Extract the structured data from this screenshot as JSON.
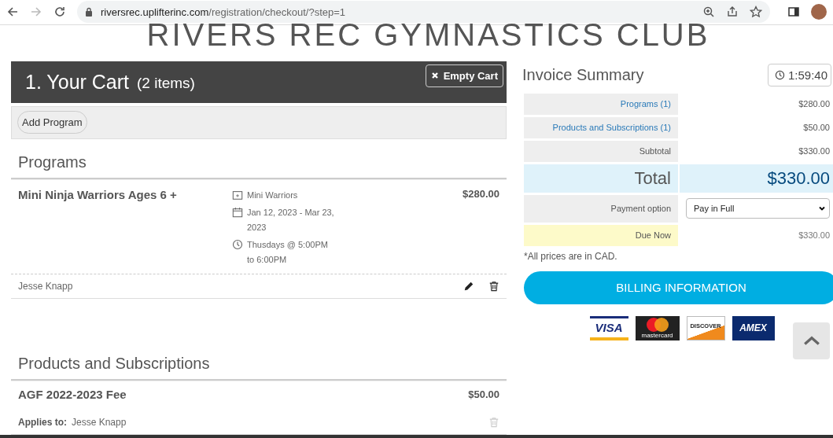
{
  "browser": {
    "url_host": "riversrec.uplifterinc.com",
    "url_path": "/registration/checkout/?step=1",
    "forward_disabled": true
  },
  "site_title": "RIVERS REC GYMNASTICS CLUB",
  "cart": {
    "title": "1. Your Cart",
    "count": "(2 items)",
    "empty_button": "Empty Cart",
    "add_button": "Add Program",
    "programs_heading": "Programs",
    "programs": [
      {
        "name": "Mini Ninja Warriors Ages 6 +",
        "group": "Mini Warriors",
        "dates": "Jan 12, 2023 - Mar 23, 2023",
        "schedule": "Thusdays @ 5:00PM to 6:00PM",
        "price": "$280.00",
        "participant": "Jesse Knapp"
      }
    ],
    "products_heading": "Products and Subscriptions",
    "products": [
      {
        "name": "AGF 2022-2023 Fee",
        "price": "$50.00",
        "applies_label": "Applies to:",
        "applies_to": "Jesse Knapp",
        "removable": false
      }
    ]
  },
  "invoice": {
    "title": "Invoice Summary",
    "timer": "1:59:40",
    "rows": [
      {
        "kind": "link",
        "label": "Programs (1)",
        "value": "$280.00"
      },
      {
        "kind": "link",
        "label": "Products and Subscriptions (1)",
        "value": "$50.00"
      },
      {
        "kind": "plain",
        "label": "Subtotal",
        "value": "$330.00"
      },
      {
        "kind": "total",
        "label": "Total",
        "value": "$330.00"
      },
      {
        "kind": "select",
        "label": "Payment option",
        "value": "Pay in Full"
      },
      {
        "kind": "due",
        "label": "Due Now",
        "value": "$330.00"
      }
    ],
    "note": "*All prices are in CAD.",
    "billing_button": "BILLING INFORMATION",
    "cards": [
      {
        "kind": "visa",
        "label": "VISA"
      },
      {
        "kind": "mastercard",
        "label": "mastercard"
      },
      {
        "kind": "discover",
        "label": "DISCOVER"
      },
      {
        "kind": "amex",
        "label": "AMEX"
      }
    ]
  }
}
